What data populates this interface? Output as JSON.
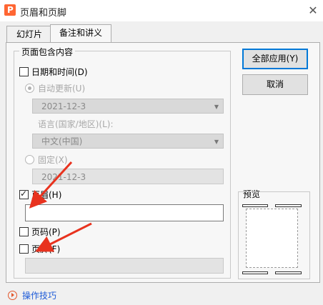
{
  "window": {
    "title": "页眉和页脚",
    "app_icon_letter": "P",
    "close_glyph": "✕"
  },
  "tabs": [
    {
      "label": "幻灯片",
      "active": false
    },
    {
      "label": "备注和讲义",
      "active": true
    }
  ],
  "group": {
    "legend": "页面包含内容",
    "datetime": {
      "label": "日期和时间(D)",
      "checked": false,
      "auto_update": {
        "label": "自动更新(U)",
        "selected": true,
        "date_value": "2021-12-3"
      },
      "language_label": "语言(国家/地区)(L):",
      "language_value": "中文(中国)",
      "fixed": {
        "label": "固定(X)",
        "selected": false,
        "value": "2021-12-3"
      }
    },
    "header": {
      "label": "页眉(H)",
      "checked": true,
      "value": ""
    },
    "page_number": {
      "label": "页码(P)",
      "checked": false
    },
    "footer": {
      "label": "页脚(F)",
      "checked": false,
      "value": ""
    }
  },
  "buttons": {
    "apply_all": "全部应用(Y)",
    "cancel": "取消"
  },
  "preview": {
    "label": "预览"
  },
  "help": {
    "label": "操作技巧"
  },
  "colors": {
    "accent": "#0078d7",
    "annotation_arrow": "#e8321e",
    "link": "#1e5bd8",
    "app_icon": "#ff6633"
  },
  "icons": {
    "dropdown": "chevron-down-icon",
    "close": "close-icon",
    "help": "play-circle-icon"
  }
}
